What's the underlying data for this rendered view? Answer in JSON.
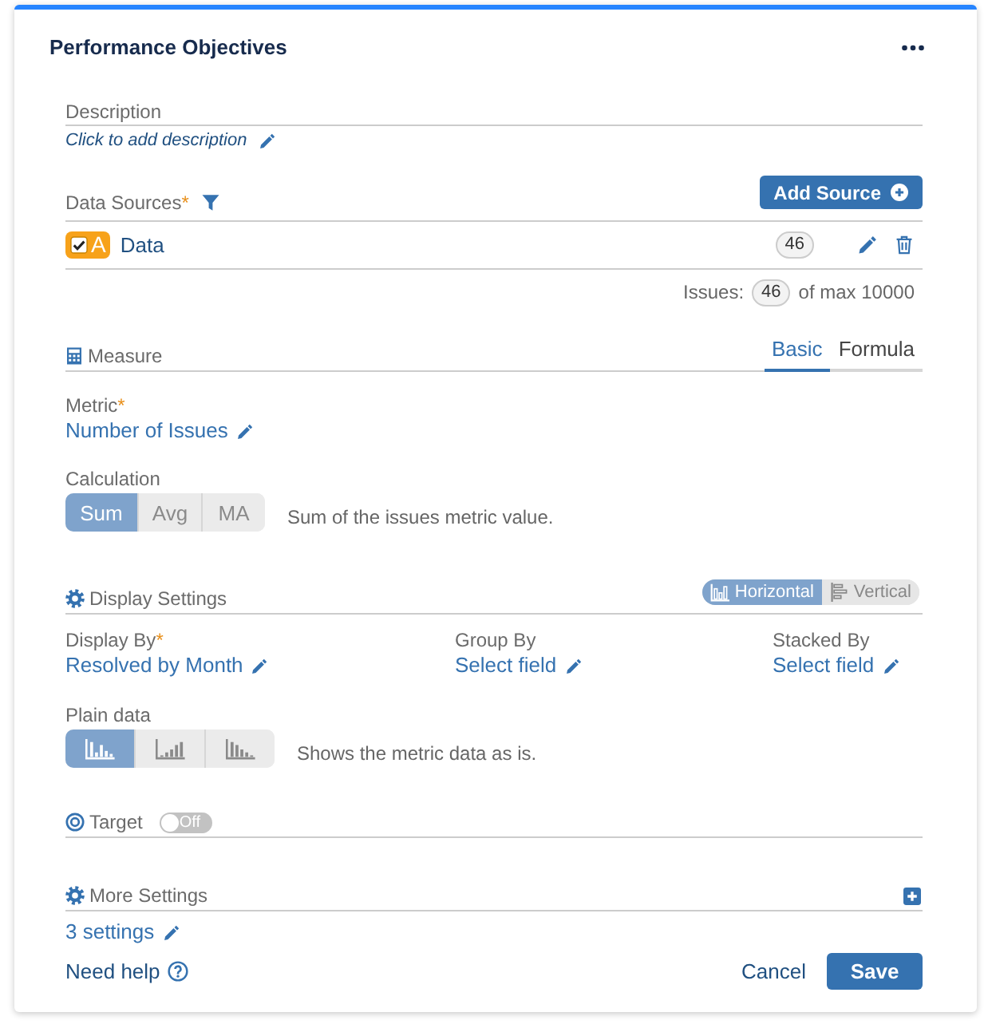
{
  "panel": {
    "title": "Performance Objectives"
  },
  "description": {
    "label": "Description",
    "prompt": "Click to add description"
  },
  "data_sources": {
    "label": "Data Sources",
    "required_mark": "*",
    "add_button": "Add Source",
    "items": [
      {
        "badge": "A",
        "checked": true,
        "name": "Data",
        "count": "46"
      }
    ],
    "issues_label": "Issues:",
    "issues_count": "46",
    "issues_max": "of max 10000"
  },
  "measure": {
    "title": "Measure",
    "tabs": [
      {
        "label": "Basic",
        "selected": true
      },
      {
        "label": "Formula",
        "selected": false
      }
    ],
    "metric": {
      "label": "Metric",
      "required_mark": "*",
      "value": "Number of Issues"
    },
    "calculation": {
      "label": "Calculation",
      "options": [
        {
          "label": "Sum",
          "selected": true
        },
        {
          "label": "Avg",
          "selected": false
        },
        {
          "label": "MA",
          "selected": false
        }
      ],
      "hint": "Sum of the issues metric value."
    }
  },
  "display_settings": {
    "title": "Display Settings",
    "orientation": [
      {
        "kind": "columns",
        "label": "Horizontal",
        "selected": true
      },
      {
        "kind": "rows",
        "label": "Vertical",
        "selected": false
      }
    ],
    "fields": [
      {
        "label": "Display By",
        "required_mark": "*",
        "value": "Resolved by Month"
      },
      {
        "label": "Group By",
        "value": "Select field"
      },
      {
        "label": "Stacked By",
        "value": "Select field"
      }
    ],
    "plain_data": {
      "label": "Plain data",
      "options": [
        {
          "kind": "unsorted",
          "selected": true
        },
        {
          "kind": "ascending",
          "selected": false
        },
        {
          "kind": "descending",
          "selected": false
        }
      ],
      "hint": "Shows the metric data as is."
    }
  },
  "target": {
    "title": "Target",
    "toggle": {
      "on": false,
      "label": "Off"
    }
  },
  "more_settings": {
    "title": "More Settings",
    "value": "3 settings"
  },
  "footer": {
    "help": "Need help",
    "cancel": "Cancel",
    "save": "Save"
  }
}
